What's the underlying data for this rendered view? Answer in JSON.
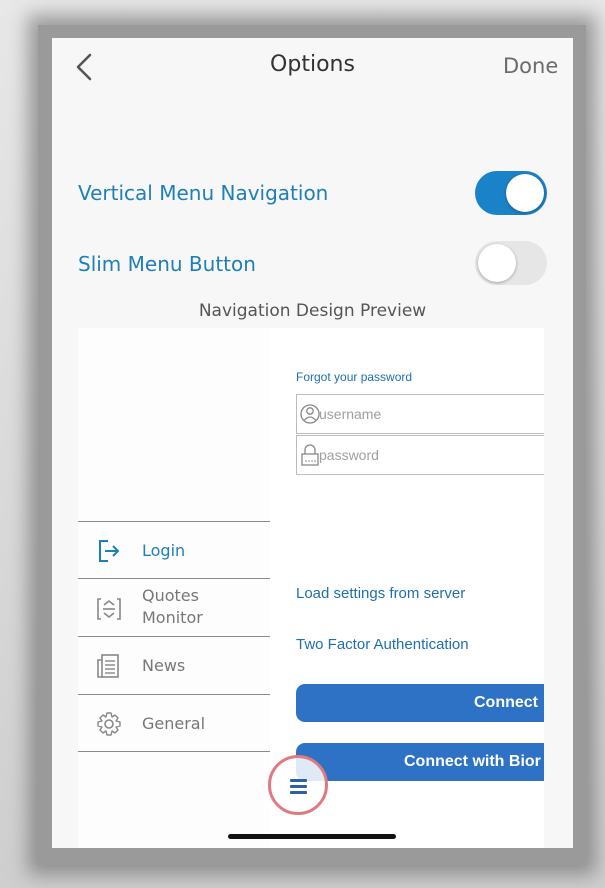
{
  "nav": {
    "title": "Options",
    "done_label": "Done",
    "back_icon": "chevron-left-icon"
  },
  "options": [
    {
      "label": "Vertical Menu Navigation",
      "enabled": true
    },
    {
      "label": "Slim Menu Button",
      "enabled": false
    }
  ],
  "preview": {
    "caption": "Navigation Design Preview",
    "menu": [
      {
        "label": "Login",
        "icon": "login-icon",
        "active": true
      },
      {
        "label": "Quotes\nMonitor",
        "icon": "quotes-monitor-icon",
        "active": false
      },
      {
        "label": "News",
        "icon": "news-icon",
        "active": false
      },
      {
        "label": "General",
        "icon": "gear-icon",
        "active": false
      }
    ],
    "login": {
      "forgot_password": "Forgot your password",
      "username_placeholder": "username",
      "password_placeholder": "password",
      "load_settings": "Load settings from server",
      "two_factor": "Two Factor Authentication",
      "connect_label": "Connect",
      "connect_bio_label": "Connect with Bior"
    },
    "slim_menu_icon": "hamburger-menu-icon"
  },
  "colors": {
    "accent": "#1a82c8",
    "button": "#2d72c4",
    "link": "#1f7fb8",
    "highlight_ring": "#e07a80"
  }
}
